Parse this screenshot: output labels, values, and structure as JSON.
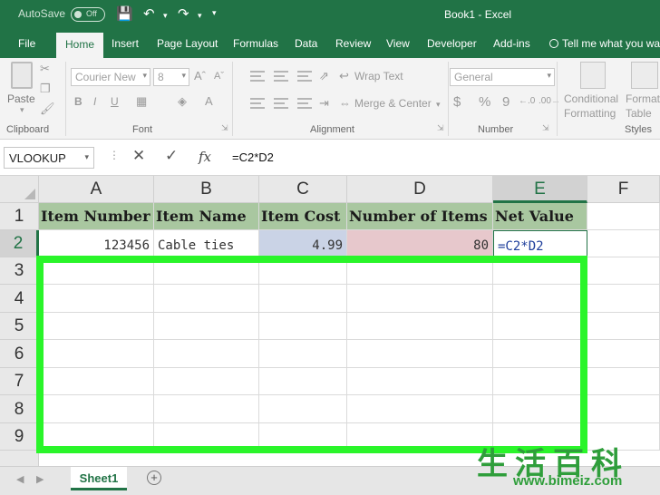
{
  "titlebar": {
    "autosave_label": "AutoSave",
    "autosave_state": "Off",
    "document_title": "Book1  -  Excel"
  },
  "tabs": [
    "File",
    "Home",
    "Insert",
    "Page Layout",
    "Formulas",
    "Data",
    "Review",
    "View",
    "Developer",
    "Add-ins"
  ],
  "tell_me": "Tell me what you wa",
  "ribbon": {
    "clipboard": {
      "paste_label": "Paste",
      "group_label": "Clipboard"
    },
    "font": {
      "font_name": "Courier New",
      "font_size": "8",
      "bold": "B",
      "italic": "I",
      "underline": "U",
      "group_label": "Font"
    },
    "alignment": {
      "wrap_text": "Wrap Text",
      "merge_center": "Merge & Center",
      "group_label": "Alignment"
    },
    "number": {
      "format": "General",
      "currency": "$",
      "percent": "%",
      "comma": "9",
      "group_label": "Number"
    },
    "styles": {
      "conditional_formatting": "Conditional Formatting",
      "format_as_table": "Format as Table",
      "group_label": "Styles"
    }
  },
  "formula_bar": {
    "name_box": "VLOOKUP",
    "cancel": "✕",
    "enter": "✓",
    "fx": "fx",
    "formula": "=C2*D2"
  },
  "columns": [
    "A",
    "B",
    "C",
    "D",
    "E",
    "F"
  ],
  "rows": [
    "1",
    "2",
    "3",
    "4",
    "5",
    "6",
    "7",
    "8",
    "9"
  ],
  "cells": {
    "A1": "Item Number",
    "B1": "Item Name",
    "C1": "Item Cost",
    "D1": "Number of Items",
    "E1": "Net Value",
    "A2": "123456",
    "B2": "Cable ties",
    "C2": "4.99",
    "D2": "80",
    "E2": "=C2*D2"
  },
  "sheets": [
    "Sheet1"
  ],
  "add_sheet": "+",
  "watermark": {
    "chinese": "生活百科",
    "url": "www.bimeiz.com"
  },
  "colors": {
    "excel_green": "#217346",
    "highlight": "#2af52a",
    "header_fill": "#a9c7a0"
  }
}
